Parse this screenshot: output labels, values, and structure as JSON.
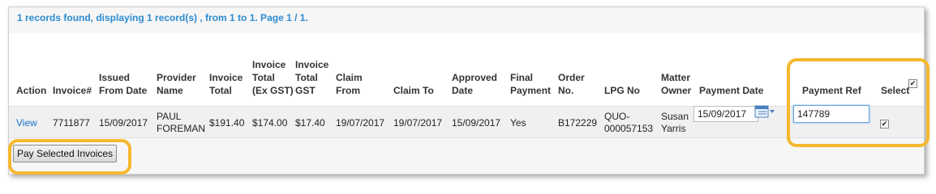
{
  "summary_text": "1 records found, displaying 1 record(s) , from 1 to 1. Page 1 / 1.",
  "columns": {
    "action": "Action",
    "invoice_no": "Invoice#",
    "issued_from_date": "Issued\nFrom Date",
    "provider_name": "Provider\nName",
    "invoice_total": "Invoice\nTotal",
    "invoice_total_ex_gst": "Invoice\nTotal\n(Ex GST)",
    "invoice_total_gst": "Invoice\nTotal\nGST",
    "claim_from": "Claim\nFrom",
    "claim_to": "Claim To",
    "approved_date": "Approved\nDate",
    "final_payment": "Final\nPayment",
    "order_no": "Order\nNo.",
    "lpg_no": "LPG No",
    "matter_owner": "Matter\nOwner",
    "payment_date": "Payment Date",
    "payment_ref": "Payment Ref",
    "select": "Select"
  },
  "row": {
    "action_link": "View",
    "invoice_no": "7711877",
    "issued_from_date": "15/09/2017",
    "provider_name": "PAUL\nFOREMAN",
    "invoice_total": "$191.40",
    "invoice_total_ex_gst": "$174.00",
    "invoice_total_gst": "$17.40",
    "claim_from": "19/07/2017",
    "claim_to": "19/07/2017",
    "approved_date": "15/09/2017",
    "final_payment": "Yes",
    "order_no": "B172229",
    "lpg_no": "QUO-\n000057153",
    "matter_owner": "Susan\nYarris",
    "payment_date": "15/09/2017",
    "payment_ref": "147789",
    "selected": true
  },
  "select_all_checked": true,
  "pay_button_label": "Pay Selected Invoices",
  "icons": {
    "calendar": "calendar-icon",
    "checkbox": "checkbox-icon"
  },
  "colors": {
    "summary_text": "#2a8bd1",
    "link": "#1a73c7",
    "highlight": "#f5b82e"
  }
}
